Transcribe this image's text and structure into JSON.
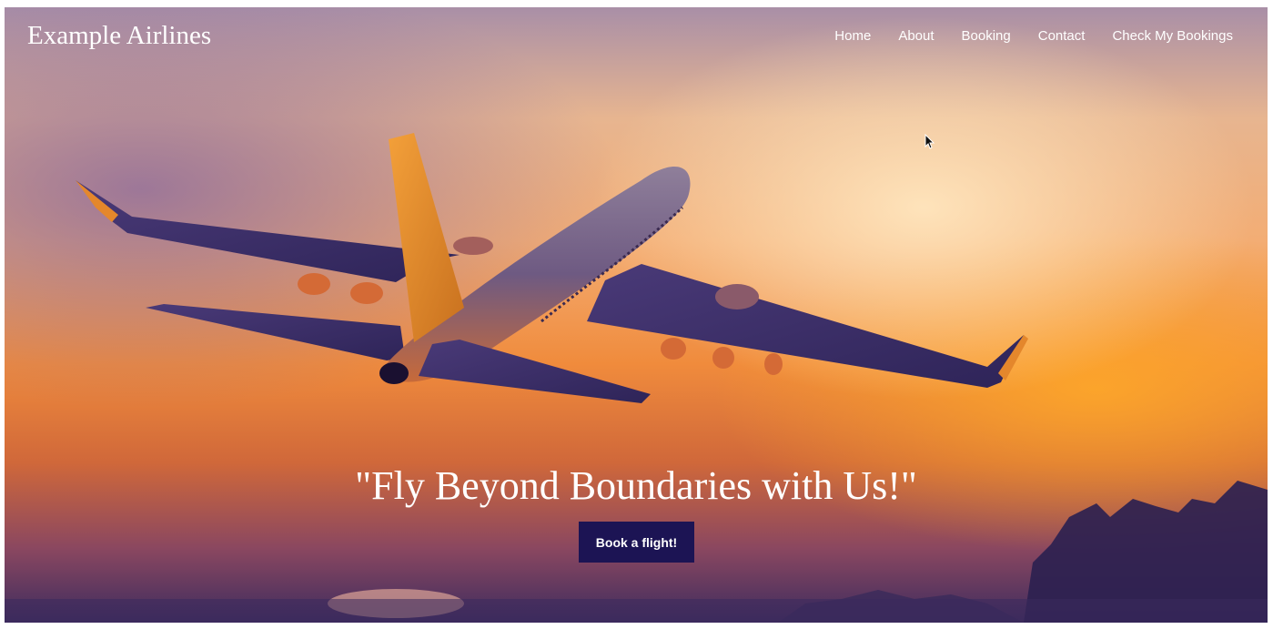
{
  "brand": {
    "name": "Example Airlines"
  },
  "nav": {
    "items": [
      {
        "label": "Home"
      },
      {
        "label": "About"
      },
      {
        "label": "Booking"
      },
      {
        "label": "Contact"
      },
      {
        "label": "Check My Bookings"
      }
    ]
  },
  "hero": {
    "tagline": "\"Fly Beyond Boundaries with Us!\"",
    "cta_label": "Book a flight!",
    "image_subject": "airplane-at-sunset"
  },
  "colors": {
    "button_bg": "#1c1454",
    "text": "#ffffff",
    "sky_top": "#a98fa7",
    "sky_mid": "#f08b3c",
    "sky_bottom": "#3e2c5e"
  },
  "icons": [
    "mouse-cursor-icon"
  ]
}
